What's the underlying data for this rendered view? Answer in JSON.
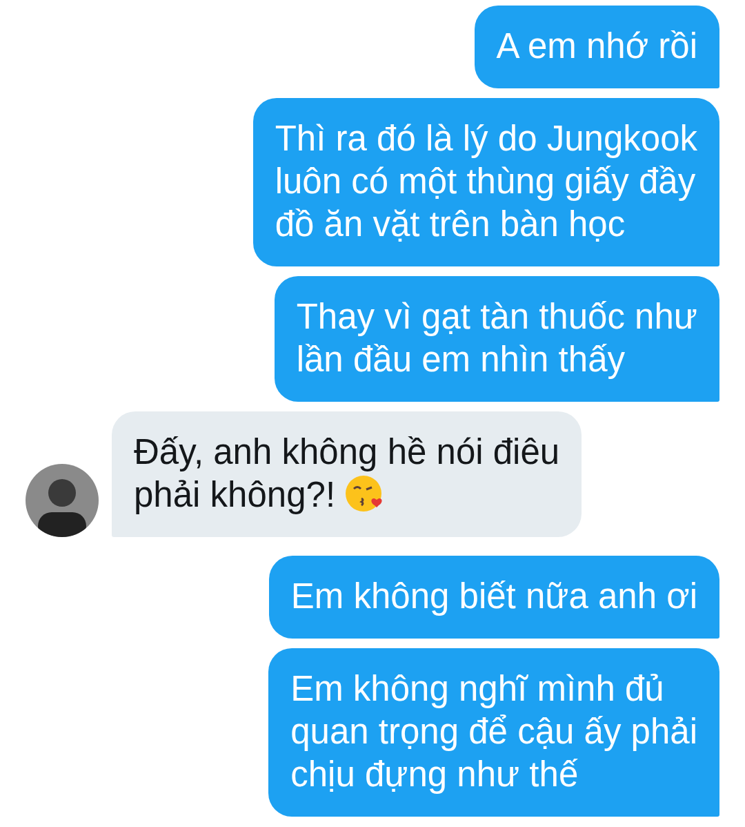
{
  "messages": [
    {
      "kind": "outgoing",
      "text": "A em nhớ rồi"
    },
    {
      "kind": "outgoing",
      "text": "Thì ra đó là lý do Jungkook\nluôn có một thùng giấy đầy\nđồ ăn vặt trên bàn học"
    },
    {
      "kind": "outgoing",
      "text": "Thay vì gạt tàn thuốc như\nlần đầu em nhìn thấy"
    },
    {
      "kind": "incoming",
      "text": "Đấy, anh không hề nói điêu\nphải không?!",
      "has_emoji": true,
      "has_avatar": true
    },
    {
      "kind": "outgoing",
      "text": "Em không biết nữa anh ơi"
    },
    {
      "kind": "outgoing",
      "text": "Em không nghĩ mình đủ\nquan trọng để cậu ấy phải\nchịu đựng như thế"
    }
  ]
}
